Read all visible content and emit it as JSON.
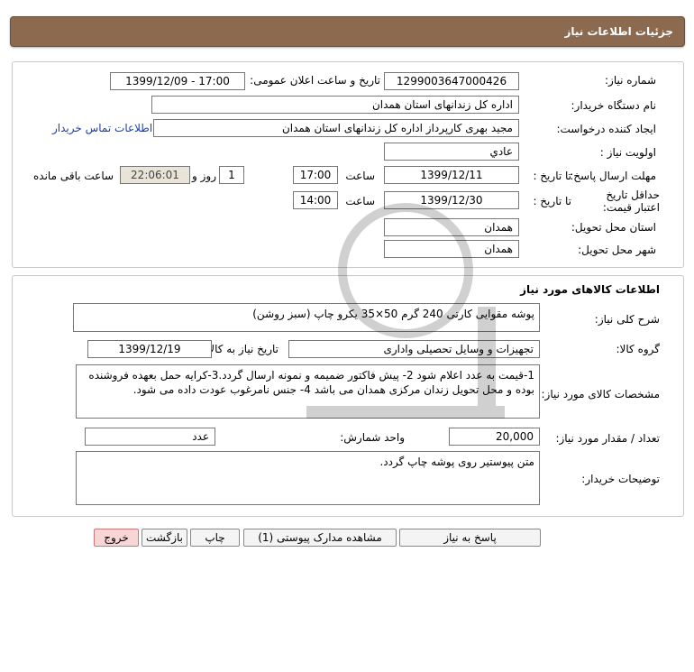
{
  "header": {
    "title": "جزئیات اطلاعات نیاز"
  },
  "details": {
    "need_number_label": "شماره نیاز:",
    "need_number": "1299003647000426",
    "announce_label": "تاریخ و ساعت اعلان عمومی:",
    "announce_value": "1399/12/09 - 17:00",
    "buyer_label": "نام دستگاه خریدار:",
    "buyer_value": "اداره کل زندانهای استان همدان",
    "requester_label": "ایجاد کننده درخواست:",
    "requester_value": "مجید بهری کارپرداز اداره کل زندانهای استان همدان",
    "contact_link": "اطلاعات تماس خریدار",
    "priority_label": "اولویت نیاز :",
    "priority_value": "عادي",
    "deadline_label": "مهلت ارسال پاسخ:",
    "to_date_label": "تا تاریخ :",
    "deadline_date": "1399/12/11",
    "time_label": "ساعت",
    "deadline_time": "17:00",
    "days_value": "1",
    "days_label": "روز و",
    "remaining_time": "22:06:01",
    "remaining_label": "ساعت باقی مانده",
    "validity_label": "حداقل تاریخ اعتبار قیمت:",
    "validity_to_date_label": "تا تاریخ :",
    "validity_date": "1399/12/30",
    "validity_time_label": "ساعت",
    "validity_time": "14:00",
    "province_label": "استان محل تحویل:",
    "province_value": "همدان",
    "city_label": "شهر محل تحویل:",
    "city_value": "همدان"
  },
  "goods": {
    "section_title": "اطلاعات کالاهای مورد نیاز",
    "description_label": "شرح کلی نیاز:",
    "description_value": "پوشه مقوایی کارتی 240 گرم 50×35 یکرو چاپ (سبز روشن)",
    "group_label": "گروه کالا:",
    "group_value": "تجهیزات و وسایل تحصیلی واداری",
    "need_date_label": "تاریخ نیاز به کالا:",
    "need_date_value": "1399/12/19",
    "specs_label": "مشخصات کالای مورد نیاز:",
    "specs_value": "1-قیمت به عدد اعلام شود 2- پیش فاکتور ضمیمه و نمونه ارسال گردد.3-کرایه حمل بعهده فروشنده بوده و محل تحویل زندان مرکزی همدان می باشد 4- جنس نامرغوب عودت داده می شود.",
    "qty_label": "تعداد / مقدار مورد نیاز:",
    "qty_value": "20,000",
    "unit_label": "واحد شمارش:",
    "unit_value": "عدد",
    "buyer_notes_label": "توضیحات خریدار:",
    "buyer_notes_value": "متن پیوستیر روی پوشه چاپ گردد."
  },
  "buttons": {
    "reply": "پاسخ به نیاز",
    "attachments": "مشاهده مدارک پیوستی (1)",
    "print": "چاپ",
    "back": "بازگشت",
    "exit": "خروج"
  },
  "colors": {
    "header_bg": "#8b6a50",
    "exit_bg": "#f9d6d6",
    "link": "#1c3fa8"
  }
}
